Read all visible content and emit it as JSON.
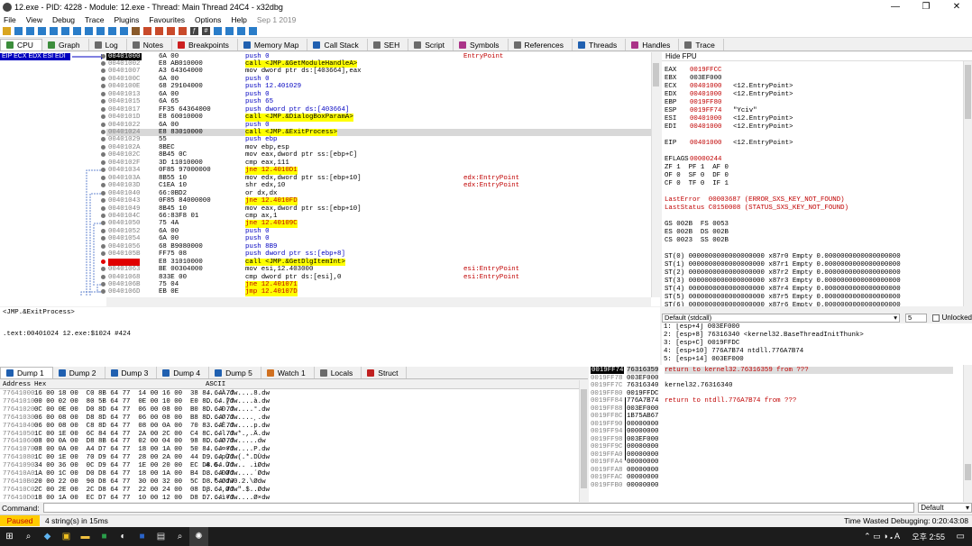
{
  "window": {
    "title": "12.exe - PID: 4228 - Module: 12.exe - Thread: Main Thread 24C4 - x32dbg",
    "min": "—",
    "max": "❐",
    "close": "✕"
  },
  "menu": [
    "File",
    "View",
    "Debug",
    "Trace",
    "Plugins",
    "Favourites",
    "Options",
    "Help"
  ],
  "menu_date": "Sep 1 2019",
  "tabs": [
    {
      "label": "CPU",
      "color": "#3c8d3c"
    },
    {
      "label": "Graph",
      "color": "#3c8d3c"
    },
    {
      "label": "Log",
      "color": "#6b6b6b"
    },
    {
      "label": "Notes",
      "color": "#6b6b6b"
    },
    {
      "label": "Breakpoints",
      "color": "#cc2020"
    },
    {
      "label": "Memory Map",
      "color": "#2060b0"
    },
    {
      "label": "Call Stack",
      "color": "#2060b0"
    },
    {
      "label": "SEH",
      "color": "#6b6b6b"
    },
    {
      "label": "Script",
      "color": "#6b6b6b"
    },
    {
      "label": "Symbols",
      "color": "#aa3388"
    },
    {
      "label": "References",
      "color": "#6b6b6b"
    },
    {
      "label": "Threads",
      "color": "#2060b0"
    },
    {
      "label": "Handles",
      "color": "#aa3388"
    },
    {
      "label": "Trace",
      "color": "#6b6b6b"
    }
  ],
  "reg_labels": "EIP ECX EDX ESI EDI",
  "disasm": [
    {
      "a": "00401000",
      "b": "6A 00",
      "i": "push 0",
      "c": "EntryPoint"
    },
    {
      "a": "00401002",
      "b": "E8 AB010000",
      "i": "call <JMP.&GetModuleHandleA>",
      "call": 1
    },
    {
      "a": "00401007",
      "b": "A3 64364000",
      "i": "mov dword ptr ds:[403664],eax"
    },
    {
      "a": "0040100C",
      "b": "6A 00",
      "i": "push 0"
    },
    {
      "a": "0040100E",
      "b": "68 29104000",
      "i": "push 12.401029"
    },
    {
      "a": "00401013",
      "b": "6A 00",
      "i": "push 0"
    },
    {
      "a": "00401015",
      "b": "6A 65",
      "i": "push 65"
    },
    {
      "a": "00401017",
      "b": "FF35 64364000",
      "i": "push dword ptr ds:[403664]"
    },
    {
      "a": "0040101D",
      "b": "E8 60010000",
      "i": "call <JMP.&DialogBoxParamA>",
      "call": 1
    },
    {
      "a": "00401022",
      "b": "6A 00",
      "i": "push 0"
    },
    {
      "a": "00401024",
      "b": "E8 83010000",
      "i": "call <JMP.&ExitProcess>",
      "call": 1,
      "sel": 1
    },
    {
      "a": "00401029",
      "b": "55",
      "i": "push ebp"
    },
    {
      "a": "0040102A",
      "b": "8BEC",
      "i": "mov ebp,esp"
    },
    {
      "a": "0040102C",
      "b": "8B45 0C",
      "i": "mov eax,dword ptr ss:[ebp+C]"
    },
    {
      "a": "0040102F",
      "b": "3D 11010000",
      "i": "cmp eax,111"
    },
    {
      "a": "00401034",
      "b": "0F85 97000000",
      "i": "jne 12.4010D1",
      "jmp": 1
    },
    {
      "a": "0040103A",
      "b": "8B55 10",
      "i": "mov edx,dword ptr ss:[ebp+10]",
      "c": "edx:EntryPoint"
    },
    {
      "a": "0040103D",
      "b": "C1EA 10",
      "i": "shr edx,10",
      "c": "edx:EntryPoint"
    },
    {
      "a": "00401040",
      "b": "66:0BD2",
      "i": "or dx,dx"
    },
    {
      "a": "00401043",
      "b": "0F85 84000000",
      "i": "jne 12.4010FD",
      "jmp": 1
    },
    {
      "a": "00401049",
      "b": "8B45 10",
      "i": "mov eax,dword ptr ss:[ebp+10]"
    },
    {
      "a": "0040104C",
      "b": "66:83F8 01",
      "i": "cmp ax,1"
    },
    {
      "a": "00401050",
      "b": "75 4A",
      "i": "jne 12.40109C",
      "jmp": 1
    },
    {
      "a": "00401052",
      "b": "6A 00",
      "i": "push 0"
    },
    {
      "a": "00401054",
      "b": "6A 00",
      "i": "push 0"
    },
    {
      "a": "00401056",
      "b": "68 B9080000",
      "i": "push 8B9"
    },
    {
      "a": "0040105B",
      "b": "FF75 08",
      "i": "push dword ptr ss:[ebp+8]"
    },
    {
      "a": "0040105E",
      "b": "E8 31010000",
      "i": "call <JMP.&GetDlgItemInt>",
      "call": 1,
      "bp": 1
    },
    {
      "a": "00401063",
      "b": "BE 00304000",
      "i": "mov esi,12.403000",
      "c": "esi:EntryPoint"
    },
    {
      "a": "00401068",
      "b": "833E 00",
      "i": "cmp dword ptr ds:[esi],0",
      "c": "esi:EntryPoint"
    },
    {
      "a": "0040106B",
      "b": "75 04",
      "i": "jne 12.401071",
      "jmp": 1
    },
    {
      "a": "0040106D",
      "b": "EB 0E",
      "i": "jmp 12.40107D",
      "jmp": 1
    }
  ],
  "regs_header": "Hide FPU",
  "regs": [
    {
      "n": "EAX",
      "v": "0019FFCC",
      "c": ""
    },
    {
      "n": "EBX",
      "v": "003EF000",
      "c": "",
      "k": 1
    },
    {
      "n": "ECX",
      "v": "00401000",
      "c": "<12.EntryPoint>"
    },
    {
      "n": "EDX",
      "v": "00401000",
      "c": "<12.EntryPoint>"
    },
    {
      "n": "EBP",
      "v": "0019FF80",
      "c": ""
    },
    {
      "n": "ESP",
      "v": "0019FF74",
      "c": "\"Yciv\""
    },
    {
      "n": "ESI",
      "v": "00401000",
      "c": "<12.EntryPoint>"
    },
    {
      "n": "EDI",
      "v": "00401000",
      "c": "<12.EntryPoint>"
    }
  ],
  "eip": {
    "n": "EIP",
    "v": "00401000",
    "c": "<12.EntryPoint>"
  },
  "eflags": {
    "n": "EFLAGS",
    "v": "00000244"
  },
  "flags": [
    "ZF 1  PF 1  AF 0",
    "OF 0  SF 0  DF 0",
    "CF 0  TF 0  IF 1"
  ],
  "lasterr": "LastError  00003687 (ERROR_SXS_KEY_NOT_FOUND)",
  "laststat": "LastStatus C0150008 (STATUS_SXS_KEY_NOT_FOUND)",
  "segs": [
    "GS 002B  FS 0053",
    "ES 002B  DS 002B",
    "CS 0023  SS 002B"
  ],
  "fpu": [
    "ST(0) 0000000000000000000 x87r0 Empty 0.0000000000000000000",
    "ST(1) 0000000000000000000 x87r1 Empty 0.0000000000000000000",
    "ST(2) 0000000000000000000 x87r2 Empty 0.0000000000000000000",
    "ST(3) 0000000000000000000 x87r3 Empty 0.0000000000000000000",
    "ST(4) 0000000000000000000 x87r4 Empty 0.0000000000000000000",
    "ST(5) 0000000000000000000 x87r5 Empty 0.0000000000000000000",
    "ST(6) 0000000000000000000 x87r6 Empty 0.0000000000000000000"
  ],
  "info": {
    "line1": "<JMP.&ExitProcess>",
    "line2": ".text:00401024 12.exe:$1024 #424"
  },
  "callconv": {
    "value": "Default (stdcall)",
    "count": "5",
    "unlocked": "Unlocked"
  },
  "args": [
    "1: [esp+4] 003EF000",
    "2: [esp+8] 76316340 <kernel32.BaseThreadInitThunk>",
    "3: [esp+C] 0019FFDC",
    "4: [esp+10] 776A7B74 ntdll.776A7B74",
    "5: [esp+14] 003EF000"
  ],
  "dumptabs": [
    "Dump 1",
    "Dump 2",
    "Dump 3",
    "Dump 4",
    "Dump 5",
    "Watch 1",
    "Locals",
    "Struct"
  ],
  "dump_hdr": {
    "addr": "Address",
    "hex": "Hex",
    "ascii": "ASCII"
  },
  "dump": [
    {
      "a": "77641000",
      "h": "16 00 18 00  C0 8B 64 77  14 00 16 00  38 84 64 77",
      "s": "....À.dw....8.dw"
    },
    {
      "a": "77641010",
      "h": "00 00 02 00  80 5B 64 77  0E 00 10 00  E0 8D 64 77",
      "s": ".....[dw....à.dw"
    },
    {
      "a": "77641020",
      "h": "0C 00 0E 00  D0 8D 64 77  06 00 08 00  B0 8D 64 77",
      "s": "....Ð.dw....°.dw"
    },
    {
      "a": "77641030",
      "h": "06 00 08 00  D8 8D 64 77  06 00 08 00  B8 8D 64 77",
      "s": "....Ø.dw....¸.dw"
    },
    {
      "a": "77641040",
      "h": "06 00 08 00  C8 8D 64 77  08 00 0A 00  70 83 64 77",
      "s": "....È.dw....p.dw"
    },
    {
      "a": "77641050",
      "h": "1C 00 1E 00  6C 84 64 77  2A 00 2C 00  C4 8C 64 77",
      "s": "....l.dw*.,.Ä.dw"
    },
    {
      "a": "77641060",
      "h": "08 00 0A 00  D8 8B 64 77  02 00 04 00  98 8D 64 77",
      "s": "....Ø.dw.....dw"
    },
    {
      "a": "77641070",
      "h": "08 00 0A 00  A4 D7 64 77  18 00 1A 00  50 84 64 77",
      "s": "....¤×dw....P.dw"
    },
    {
      "a": "77641080",
      "h": "1C 00 1E 00  70 D9 64 77  28 00 2A 00  44 D9 64 77",
      "s": "....pÙdw(.*.DÙdw"
    },
    {
      "a": "77641090",
      "h": "34 00 36 00  0C D9 64 77  1E 00 20 00  EC D8 64 77",
      "s": "4.6..Ùdw.. .ìØdw"
    },
    {
      "a": "776410A0",
      "h": "1A 00 1C 00  D0 D8 64 77  18 00 1A 00  B4 D8 64 77",
      "s": "....ÐØdw....´Ødw"
    },
    {
      "a": "776410B0",
      "h": "20 00 22 00  90 D8 64 77  30 00 32 00  5C D8 64 77",
      "s": " .\".Ødw0.2.\\Ødw"
    },
    {
      "a": "776410C0",
      "h": "2C 00 2E 00  2C D8 64 77  22 00 24 00  08 D8 64 77",
      "s": ",...,Ødw\".$..Ødw"
    },
    {
      "a": "776410D0",
      "h": "18 00 1A 00  EC D7 64 77  10 00 12 00  D8 D7 64 77",
      "s": "....ì×dw....Ø×dw"
    }
  ],
  "stack": [
    {
      "a": "0019FF74",
      "v": "76316359",
      "c": "return to kernel32.76316359 from ???",
      "sel": 1
    },
    {
      "a": "0019FF78",
      "v": "003EF000",
      "c": ""
    },
    {
      "a": "0019FF7C",
      "v": "76316340",
      "c": "kernel32.76316340",
      "k": 1
    },
    {
      "a": "0019FF80",
      "v": "0019FFDC",
      "c": ""
    },
    {
      "a": "0019FF84",
      "v": "776A7B74",
      "c": "return to ntdll.776A7B74 from ???"
    },
    {
      "a": "0019FF88",
      "v": "003EF000",
      "c": ""
    },
    {
      "a": "0019FF8C",
      "v": "1B75AB67",
      "c": ""
    },
    {
      "a": "0019FF90",
      "v": "00000000",
      "c": ""
    },
    {
      "a": "0019FF94",
      "v": "00000000",
      "c": ""
    },
    {
      "a": "0019FF98",
      "v": "003EF000",
      "c": ""
    },
    {
      "a": "0019FF9C",
      "v": "00000000",
      "c": ""
    },
    {
      "a": "0019FFA0",
      "v": "00000000",
      "c": ""
    },
    {
      "a": "0019FFA4",
      "v": "00000000",
      "c": ""
    },
    {
      "a": "0019FFA8",
      "v": "00000000",
      "c": ""
    },
    {
      "a": "0019FFAC",
      "v": "00000000",
      "c": ""
    },
    {
      "a": "0019FFB0",
      "v": "00000000",
      "c": ""
    }
  ],
  "command": {
    "label": "Command:",
    "value": "",
    "mode": "Default"
  },
  "status": {
    "state": "Paused",
    "msg": "4 string(s) in 15ms",
    "wasted": "Time Wasted Debugging: 0:20:43:08"
  },
  "taskbar": {
    "time": "오후 2:55",
    "lang": "A"
  }
}
